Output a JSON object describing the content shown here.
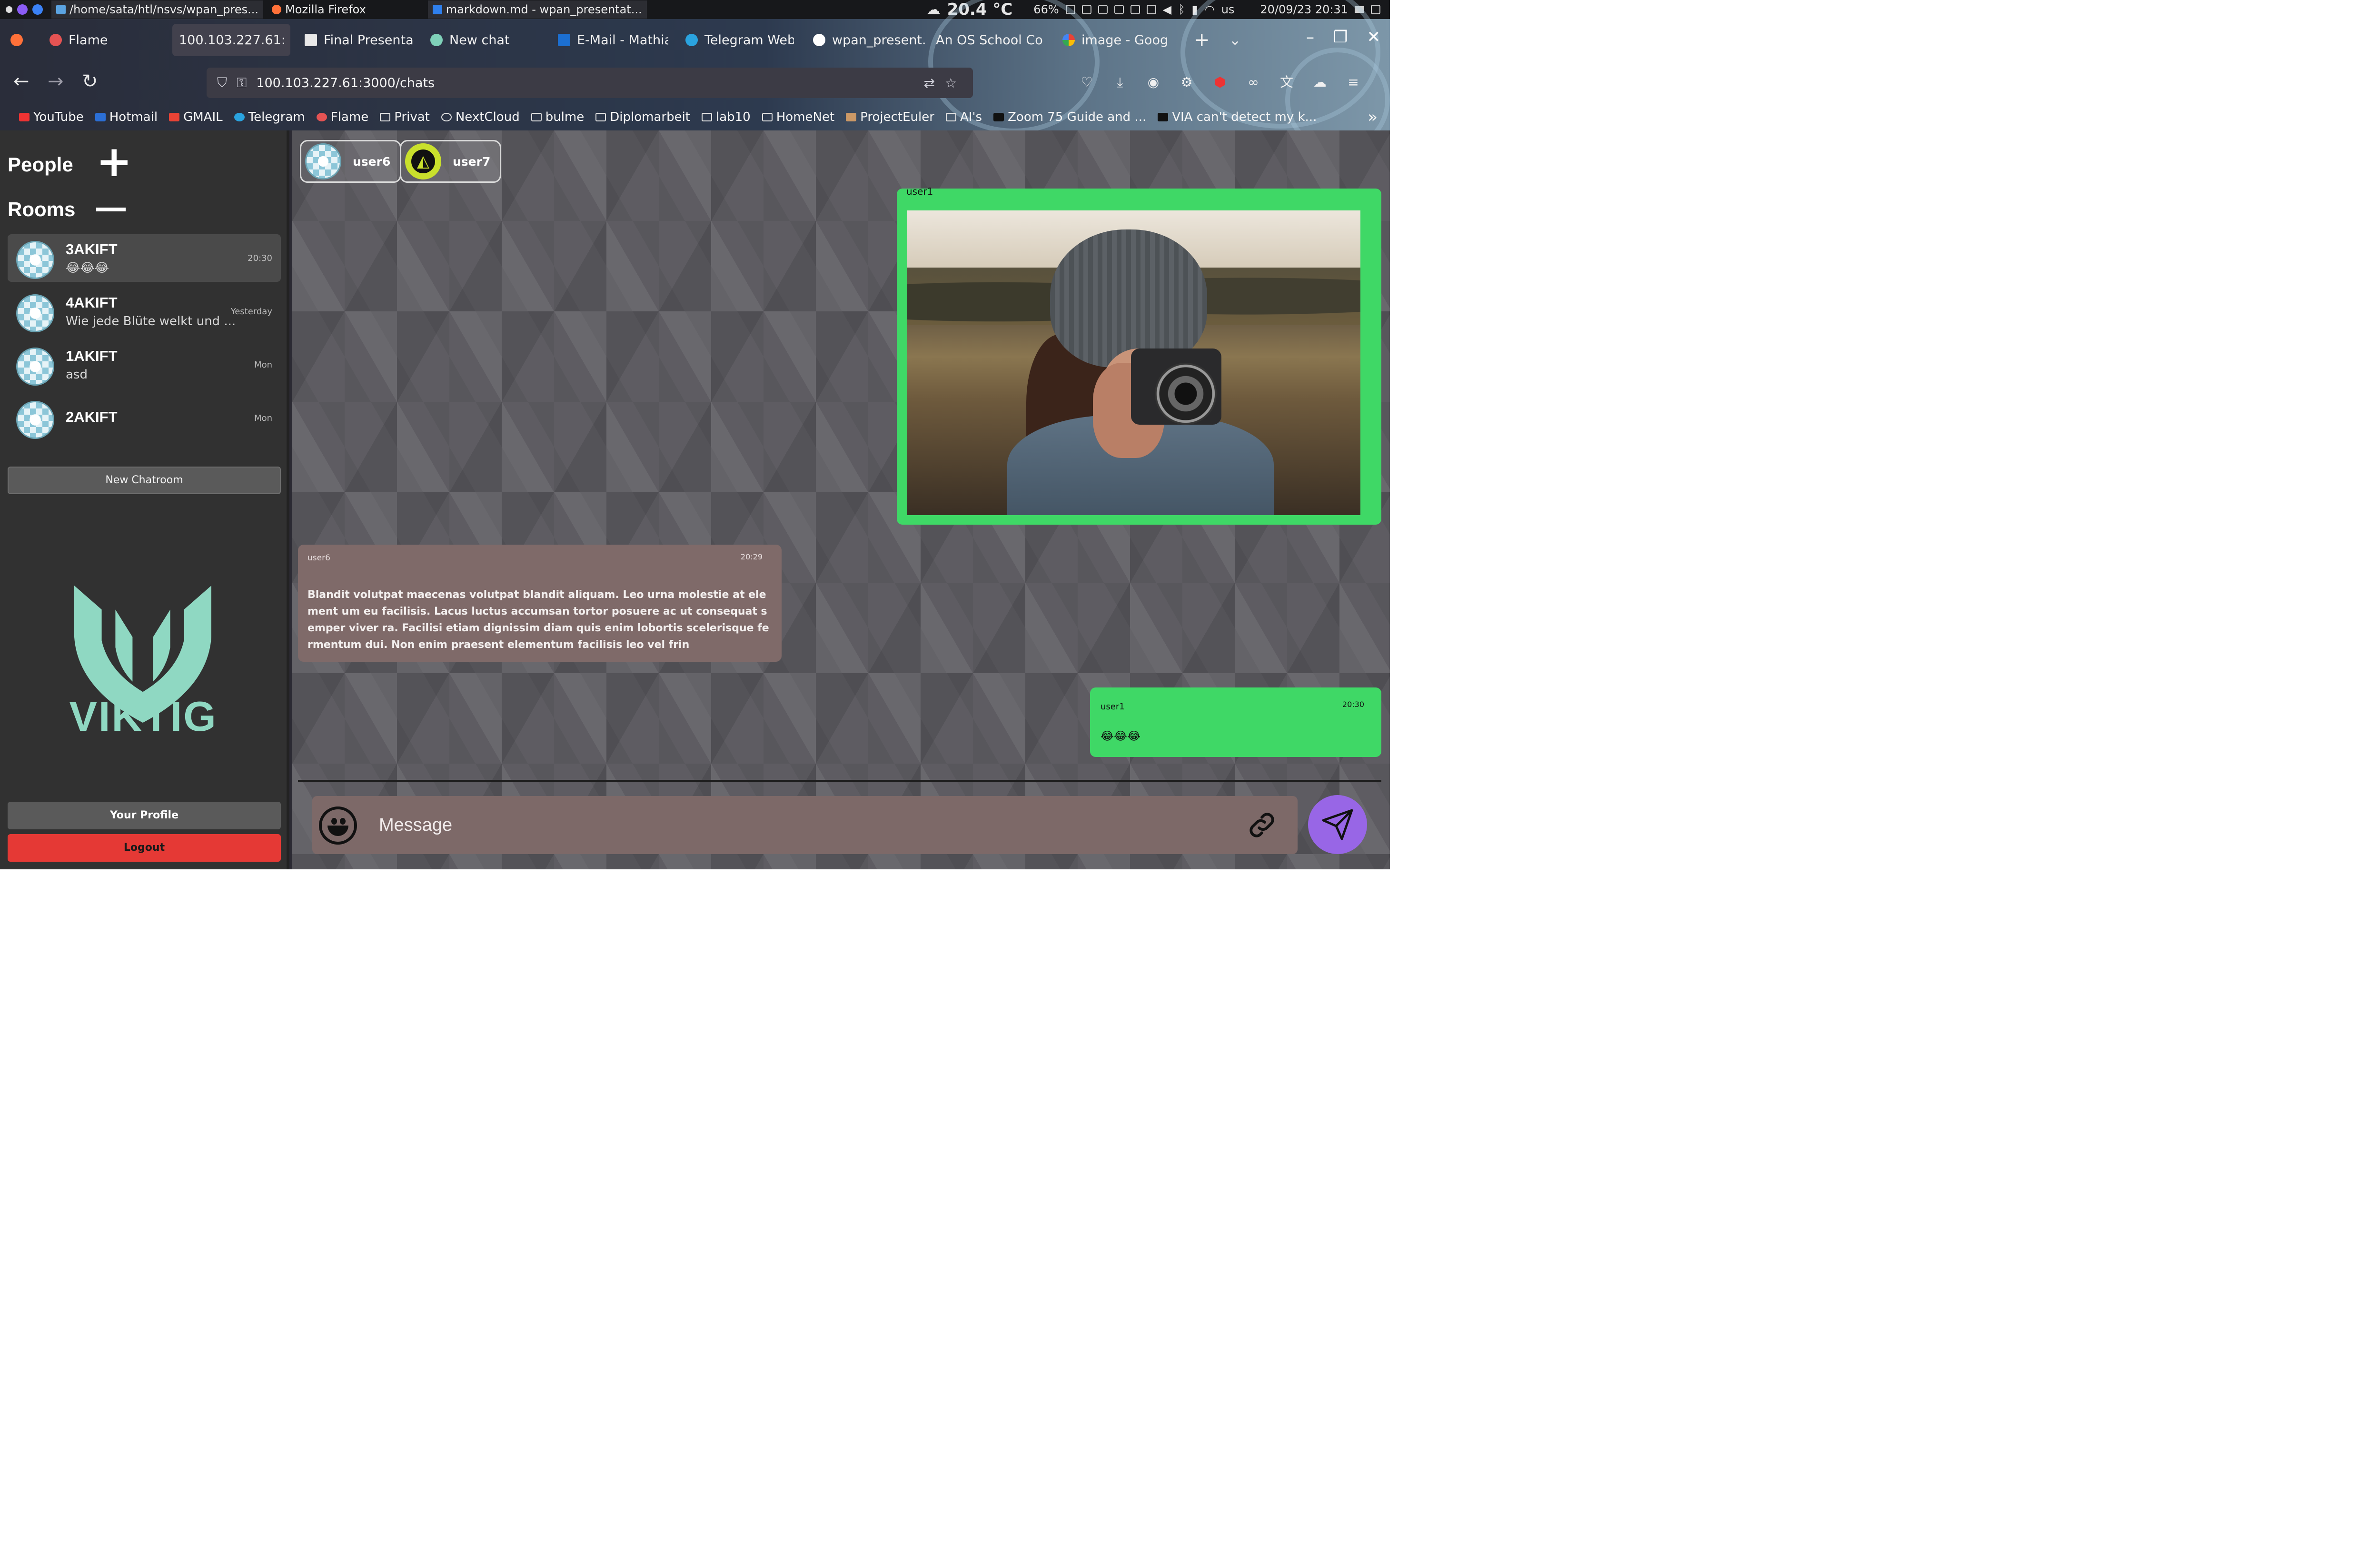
{
  "os_panel": {
    "tasks": [
      {
        "label": "/home/sata/htl/nsvs/wpan_pres..."
      },
      {
        "label": "Mozilla Firefox"
      },
      {
        "label": "markdown.md - wpan_presentat..."
      }
    ],
    "weather": "20.4 °C",
    "battery": "66%",
    "keyboard_layout": "us",
    "datetime": "20/09/23  20:31"
  },
  "browser": {
    "tabs": [
      {
        "label": "Flame"
      },
      {
        "label": "100.103.227.61:"
      },
      {
        "label": "Final Presentati"
      },
      {
        "label": "New chat"
      },
      {
        "label": "E-Mail - Mathia"
      },
      {
        "label": "Telegram Web"
      },
      {
        "label": "wpan_present..."
      },
      {
        "label": "An OS School Co"
      },
      {
        "label": "image - Goog"
      }
    ],
    "url": "100.103.227.61:3000/chats",
    "bookmarks": [
      {
        "label": "YouTube"
      },
      {
        "label": "Hotmail"
      },
      {
        "label": "GMAIL"
      },
      {
        "label": "Telegram"
      },
      {
        "label": "Flame"
      },
      {
        "label": "Privat"
      },
      {
        "label": "NextCloud"
      },
      {
        "label": "bulme"
      },
      {
        "label": "Diplomarbeit"
      },
      {
        "label": "lab10"
      },
      {
        "label": "HomeNet"
      },
      {
        "label": "ProjectEuler"
      },
      {
        "label": "AI's"
      },
      {
        "label": "Zoom 75 Guide and ..."
      },
      {
        "label": "VIA can't detect my k..."
      }
    ]
  },
  "sidebar": {
    "people_title": "People",
    "rooms_title": "Rooms",
    "rooms": [
      {
        "name": "3AKIFT",
        "last": "😂😂😂",
        "time": "20:30",
        "active": true
      },
      {
        "name": "4AKIFT",
        "last": "Wie jede Blüte welkt und ...",
        "time": "Yesterday"
      },
      {
        "name": "1AKIFT",
        "last": "asd",
        "time": "Mon"
      },
      {
        "name": "2AKIFT",
        "last": "",
        "time": "Mon"
      }
    ],
    "new_chatroom_label": "New Chatroom",
    "logo_text": "VIKTIG",
    "profile_label": "Your Profile",
    "logout_label": "Logout"
  },
  "chat": {
    "members": [
      {
        "name": "user6"
      },
      {
        "name": "user7"
      }
    ],
    "messages": [
      {
        "sender": "user1",
        "time": "",
        "type": "image"
      },
      {
        "sender": "user6",
        "time": "20:29",
        "text": "Blandit volutpat maecenas volutpat blandit aliquam. Leo urna molestie at element um eu facilisis. Lacus luctus accumsan tortor posuere ac ut consequat semper viver ra. Facilisi etiam dignissim diam quis enim lobortis scelerisque fermentum dui. Non enim praesent elementum facilisis leo vel frin"
      },
      {
        "sender": "user1",
        "time": "20:30",
        "text": "😂😂😂"
      }
    ],
    "composer_placeholder": "Message"
  },
  "colors": {
    "own_bubble": "#3fd866",
    "other_bubble": "#7f6a69",
    "send_button": "#9866e6",
    "logout": "#e53935",
    "logo": "#8fd8c2"
  }
}
